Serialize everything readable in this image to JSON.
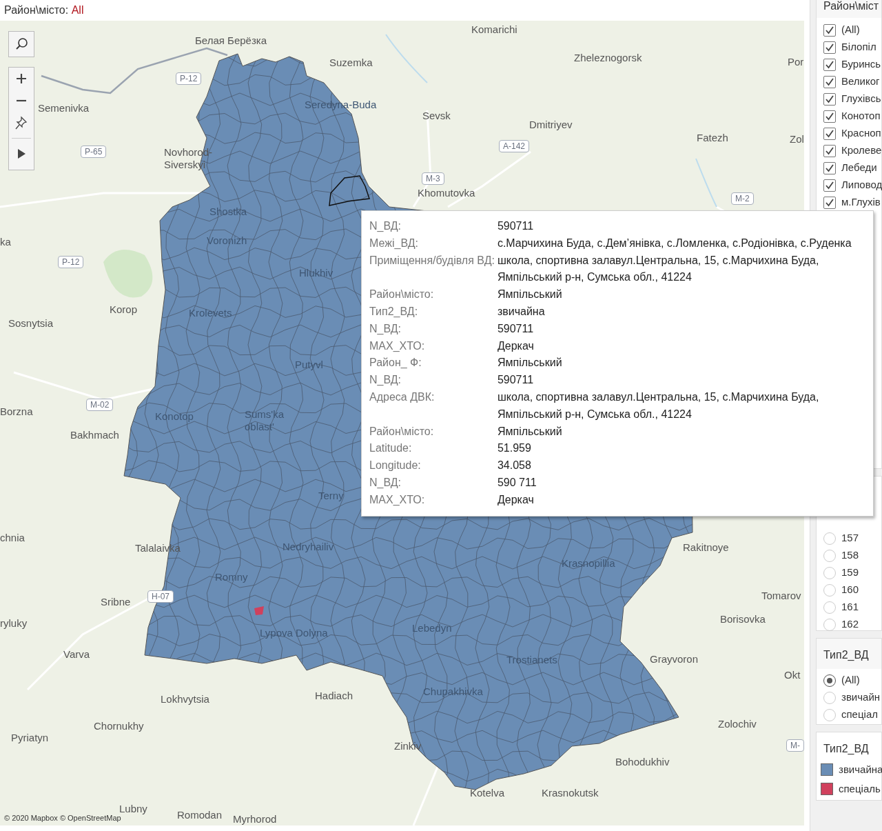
{
  "filter_title": {
    "label": "Район\\місто:",
    "value": "All"
  },
  "map": {
    "places": [
      "Белая Берёзка",
      "Komarichi",
      "Suzemka",
      "Zheleznogorsk",
      "Semenivka",
      "Seredyna-Buda",
      "Sevsk",
      "Dmitriyev",
      "Fatezh",
      "Novhorod-Siverskyi",
      "Khomutovka",
      "Shostka",
      "Voronizh",
      "Hlukhiv",
      "Korop",
      "Sosnytsia",
      "Krolevets",
      "Putyvl",
      "Borzna",
      "Bakhmach",
      "Konotop",
      "Sums'ka oblast'",
      "Terny",
      "Talalaivka",
      "Nedryhailiv",
      "Rakitnoye",
      "Romny",
      "Krasnopillia",
      "Sribne",
      "Tomarov",
      "Lypova Dolyna",
      "Lebedyn",
      "Borisovka",
      "Trostianets",
      "Varva",
      "Grayvoron",
      "Okt",
      "Hadiach",
      "Lokhvytsia",
      "Chupakhivka",
      "Chornukhy",
      "Zolochiv",
      "Pyriatyn",
      "Zinkiv",
      "Bohodukhiv",
      "Kotelva",
      "Krasnokutsk",
      "Lubny",
      "Romodan",
      "Myrhorod",
      "Por",
      "Zol",
      "ka",
      "chnia",
      "ryluky"
    ],
    "roads": [
      "P-12",
      "P-65",
      "A-142",
      "M-3",
      "M-2",
      "P-12",
      "M-02",
      "H-07",
      "M-"
    ],
    "attribution": "© 2020 Mapbox © OpenStreetMap"
  },
  "tooltip": {
    "rows": [
      {
        "label": "N_ВД:",
        "value": "590711"
      },
      {
        "label": "Межі_ВД:",
        "value": "с.Марчихина Буда, с.Дем’янівка, с.Ломленка, с.Родіонівка, с.Руденка"
      },
      {
        "label": "Приміщення/будівля ВД:",
        "value": "школа, спортивна залавул.Центральна, 15, с.Марчихина Буда, Ямпільський р-н, Сумська обл., 41224"
      },
      {
        "label": "Район\\місто:",
        "value": "Ямпільський"
      },
      {
        "label": "Тип2_ВД:",
        "value": "звичайна"
      },
      {
        "label": "N_ВД:",
        "value": "590711"
      },
      {
        "label": "МАХ_ХТО:",
        "value": "Деркач"
      },
      {
        "label": "Район_ Ф:",
        "value": "Ямпільський"
      },
      {
        "label": "N_ВД:",
        "value": "590711"
      },
      {
        "label": "Адреса ДВК:",
        "value": "школа, спортивна залавул.Центральна, 15, с.Марчихина Буда, Ямпільський р-н, Сумська обл., 41224"
      },
      {
        "label": "Район\\місто:",
        "value": "Ямпільський"
      },
      {
        "label": "Latitude:",
        "value": "51.959"
      },
      {
        "label": "Longitude:",
        "value": "34.058"
      },
      {
        "label": "N_ВД:",
        "value": "590 711"
      },
      {
        "label": "МАХ_ХТО:",
        "value": "Деркач"
      }
    ]
  },
  "sidebar": {
    "district_filter": {
      "title": "Район\\міст",
      "items": [
        {
          "label": "(All)",
          "checked": true
        },
        {
          "label": "Білопіл",
          "checked": true
        },
        {
          "label": "Буринсь",
          "checked": true
        },
        {
          "label": "Великог",
          "checked": true
        },
        {
          "label": "Глухівсь",
          "checked": true
        },
        {
          "label": "Конотоп",
          "checked": true
        },
        {
          "label": "Красноп",
          "checked": true
        },
        {
          "label": "Кролеве",
          "checked": true
        },
        {
          "label": "Лебеди",
          "checked": true
        },
        {
          "label": "Липовод",
          "checked": true
        },
        {
          "label": "м.Глухів",
          "checked": true
        }
      ]
    },
    "number_filter": {
      "items": [
        {
          "label": "157",
          "selected": false
        },
        {
          "label": "158",
          "selected": false
        },
        {
          "label": "159",
          "selected": false
        },
        {
          "label": "160",
          "selected": false
        },
        {
          "label": "161",
          "selected": false
        },
        {
          "label": "162",
          "selected": false
        }
      ]
    },
    "type_filter": {
      "title": "Тип2_ВД",
      "items": [
        {
          "label": "(All)",
          "selected": true
        },
        {
          "label": "звичайн",
          "selected": false
        },
        {
          "label": "спеціал",
          "selected": false
        }
      ]
    },
    "legend": {
      "title": "Тип2_ВД",
      "items": [
        {
          "label": "звичайна",
          "color": "#6a8db5"
        },
        {
          "label": "спеціаль",
          "color": "#d0415d"
        }
      ]
    }
  }
}
